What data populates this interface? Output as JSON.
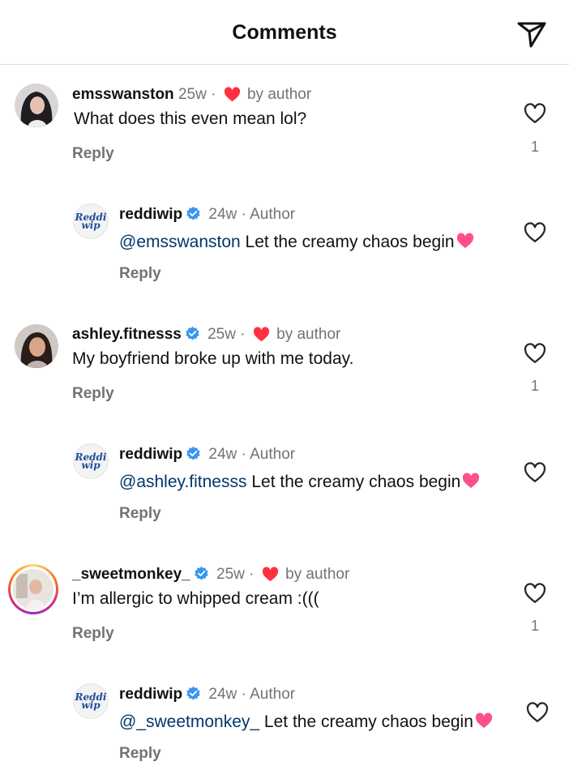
{
  "header": {
    "title": "Comments"
  },
  "colors": {
    "blue_check": "#3797f0",
    "heart_red": "#ff3040",
    "inline_heart": "#ff4f8b",
    "mention": "#00376b"
  },
  "comments": [
    {
      "username": "emsswanston",
      "verified": false,
      "time": "25w",
      "sep": "·",
      "liked_by": "by author",
      "text": "What does this even mean lol?",
      "reply_label": "Reply",
      "likes": "1",
      "reply": {
        "username": "reddiwip",
        "time": "24w",
        "sep": "·",
        "role": "Author",
        "mention": "@emsswanston",
        "text": " Let the creamy chaos begin",
        "reply_label": "Reply",
        "logo": "Reddi wip"
      }
    },
    {
      "username": "ashley.fitnesss",
      "verified": true,
      "time": "25w",
      "sep": "·",
      "liked_by": "by author",
      "text": "My boyfriend broke up with me today.",
      "reply_label": "Reply",
      "likes": "1",
      "reply": {
        "username": "reddiwip",
        "time": "24w",
        "sep": "·",
        "role": "Author",
        "mention": "@ashley.fitnesss",
        "text": " Let the creamy chaos begin",
        "reply_label": "Reply",
        "logo": "Reddi wip"
      }
    },
    {
      "username": "_sweetmonkey_",
      "verified": true,
      "time": "25w",
      "sep": "·",
      "liked_by": "by author",
      "text": "I’m allergic to whipped cream :(((",
      "reply_label": "Reply",
      "likes": "1",
      "reply": {
        "username": "reddiwip",
        "time": "24w",
        "sep": "·",
        "role": "Author",
        "mention": "@_sweetmonkey_",
        "text": " Let the creamy chaos begin",
        "reply_label": "Reply",
        "logo": "Reddi wip"
      }
    }
  ]
}
